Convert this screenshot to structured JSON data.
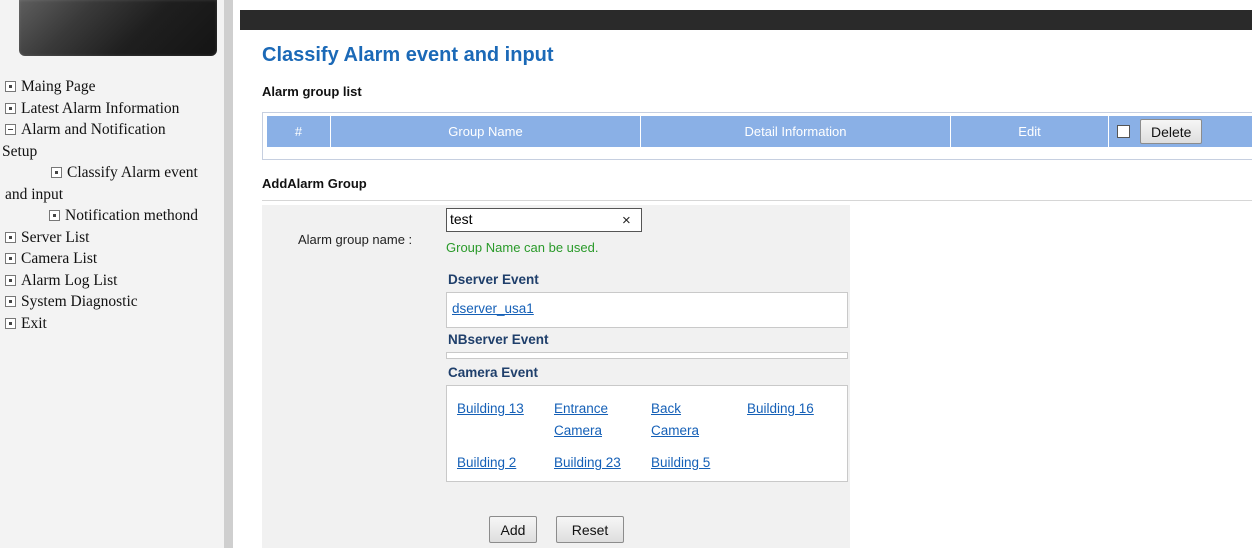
{
  "sidebar": {
    "items": [
      {
        "label": "Maing Page"
      },
      {
        "label": "Latest Alarm Information"
      },
      {
        "label": "Alarm and Notification"
      },
      {
        "label": "Setup"
      },
      {
        "label": "Classify Alarm event"
      },
      {
        "label": "and input"
      },
      {
        "label": "Notification methond"
      },
      {
        "label": "Server List"
      },
      {
        "label": "Camera List"
      },
      {
        "label": "Alarm Log List"
      },
      {
        "label": "System Diagnostic"
      },
      {
        "label": "Exit"
      }
    ]
  },
  "main": {
    "title": "Classify Alarm event and input",
    "group_list_label": "Alarm group list",
    "table": {
      "columns": [
        "#",
        "Group Name",
        "Detail Information",
        "Edit"
      ],
      "delete_label": "Delete"
    },
    "add_section_label": "AddAlarm Group",
    "form": {
      "name_label": "Alarm group name :",
      "name_value": "test",
      "clear_glyph": "×",
      "valid_message": "Group Name can be used.",
      "dserver_title": "Dserver Event",
      "dserver_items": [
        "dserver_usa1"
      ],
      "nbserver_title": "NBserver Event",
      "camera_title": "Camera Event",
      "camera_items": [
        "Building 13",
        "Entrance Camera",
        "Back Camera",
        "Building 16",
        "Building 2",
        "Building 23",
        "Building 5"
      ],
      "add_label": "Add",
      "reset_label": "Reset"
    }
  },
  "colors": {
    "title_blue": "#1b69b7",
    "header_blue": "#8ab0e6",
    "link_blue": "#1560b7",
    "valid_green": "#2a9a2a",
    "topbar": "#2a2a2a"
  }
}
